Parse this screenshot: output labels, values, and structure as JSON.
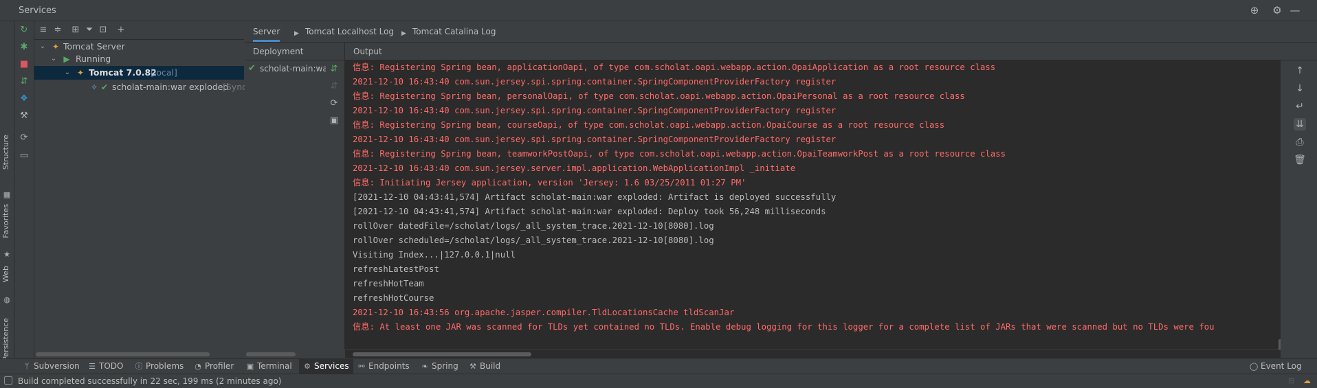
{
  "window": {
    "title": "Services"
  },
  "title_icons": [
    "crosshair-icon",
    "gear-icon",
    "minimize-icon"
  ],
  "side_tabs": {
    "structure": "Structure",
    "favorites": "Favorites",
    "web": "Web",
    "persistence": "Persistence"
  },
  "tree": {
    "tomcat_server": "Tomcat Server",
    "running": "Running",
    "tomcat_instance": {
      "name": "Tomcat 7.0.82",
      "tag": "[local]"
    },
    "artifact": {
      "name": "scholat-main:war exploded",
      "status": "[Sync"
    }
  },
  "tabs": [
    "Server",
    "Tomcat Localhost Log",
    "Tomcat Catalina Log"
  ],
  "deployment": {
    "header": "Deployment",
    "items": [
      "scholat-main:wa"
    ]
  },
  "output": {
    "header": "Output",
    "lines": [
      {
        "text": "信息: Registering Spring bean, applicationOapi, of type com.scholat.oapi.webapp.action.OpaiApplication as a root resource class",
        "kind": "err"
      },
      {
        "text": "2021-12-10 16:43:40 com.sun.jersey.spi.spring.container.SpringComponentProviderFactory register",
        "kind": "err"
      },
      {
        "text": "信息: Registering Spring bean, personalOapi, of type com.scholat.oapi.webapp.action.OpaiPersonal as a root resource class",
        "kind": "err"
      },
      {
        "text": "2021-12-10 16:43:40 com.sun.jersey.spi.spring.container.SpringComponentProviderFactory register",
        "kind": "err"
      },
      {
        "text": "信息: Registering Spring bean, courseOapi, of type com.scholat.oapi.webapp.action.OpaiCourse as a root resource class",
        "kind": "err"
      },
      {
        "text": "2021-12-10 16:43:40 com.sun.jersey.spi.spring.container.SpringComponentProviderFactory register",
        "kind": "err"
      },
      {
        "text": "信息: Registering Spring bean, teamworkPostOapi, of type com.scholat.oapi.webapp.action.OpaiTeamworkPost as a root resource class",
        "kind": "err"
      },
      {
        "text": "2021-12-10 16:43:40 com.sun.jersey.server.impl.application.WebApplicationImpl _initiate",
        "kind": "err"
      },
      {
        "text": "信息: Initiating Jersey application, version 'Jersey: 1.6 03/25/2011 01:27 PM'",
        "kind": "err"
      },
      {
        "text": "[2021-12-10 04:43:41,574] Artifact scholat-main:war exploded: Artifact is deployed successfully",
        "kind": "out"
      },
      {
        "text": "[2021-12-10 04:43:41,574] Artifact scholat-main:war exploded: Deploy took 56,248 milliseconds",
        "kind": "out"
      },
      {
        "text": "rollOver datedFile=/scholat/logs/_all_system_trace.2021-12-10[8080].log",
        "kind": "out"
      },
      {
        "text": "rollOver scheduled=/scholat/logs/_all_system_trace.2021-12-10[8080].log",
        "kind": "out"
      },
      {
        "text": "Visiting Index...|127.0.0.1|null",
        "kind": "out"
      },
      {
        "text": "refreshLatestPost",
        "kind": "out"
      },
      {
        "text": "refreshHotTeam",
        "kind": "out"
      },
      {
        "text": "refreshHotCourse",
        "kind": "out"
      },
      {
        "text": "2021-12-10 16:43:56 org.apache.jasper.compiler.TldLocationsCache tldScanJar",
        "kind": "err"
      },
      {
        "text": "信息: At least one JAR was scanned for TLDs yet contained no TLDs. Enable debug logging for this logger for a complete list of JARs that were scanned but no TLDs were fou",
        "kind": "err"
      }
    ]
  },
  "tool_windows": [
    "Subversion",
    "TODO",
    "Problems",
    "Profiler",
    "Terminal",
    "Services",
    "Endpoints",
    "Spring",
    "Build"
  ],
  "active_tool_window": "Services",
  "event_log": "Event Log",
  "status": {
    "message": "Build completed successfully in 22 sec, 199 ms (2 minutes ago)"
  },
  "colors": {
    "background": "#3c3f41",
    "console_bg": "#2b2b2b",
    "error_text": "#ff6b68",
    "normal_text": "#bbbbbb",
    "selection": "#0d293e",
    "running_green": "#59a869",
    "accent_blue": "#4a88c7"
  }
}
